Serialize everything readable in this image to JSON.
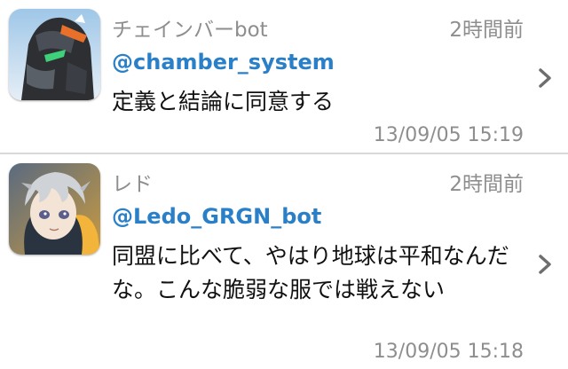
{
  "tweets": [
    {
      "display_name": "チェインバーbot",
      "handle": "@chamber_system",
      "relative_time": "2時間前",
      "text": "定義と結論に同意する",
      "timestamp": "13/09/05 15:19",
      "avatar_icon": "robot-avatar-icon"
    },
    {
      "display_name": "レド",
      "handle": "@Ledo_GRGN_bot",
      "relative_time": "2時間前",
      "text": "同盟に比べて、やはり地球は平和なんだな。こんな脆弱な服では戦えない",
      "timestamp": "13/09/05 15:18",
      "avatar_icon": "anime-character-avatar-icon"
    }
  ],
  "colors": {
    "handle": "#2a80c8",
    "meta": "#8e8e8e",
    "body": "#111111",
    "divider": "#d9d9d9"
  }
}
